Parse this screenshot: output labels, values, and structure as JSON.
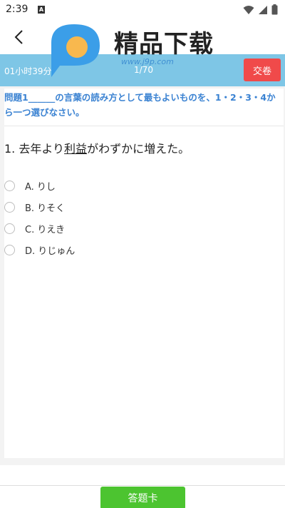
{
  "status_bar": {
    "time": "2:39",
    "app_icon_letter": "A",
    "icons": [
      "wifi-icon",
      "signal-icon",
      "battery-icon"
    ]
  },
  "header": {
    "back_icon": "chevron-left-icon"
  },
  "watermark": {
    "brand_text": "精品下载",
    "url": "www.j9p.com"
  },
  "info_bar": {
    "timer": "01小时39分",
    "progress": "1/70",
    "submit_label": "交卷"
  },
  "question": {
    "instruction": "問題1______の言葉の読み方として最もよいものを、1・2・3・4から一つ選びなさい。",
    "prefix": "1. 去年より",
    "keyword": "利益",
    "suffix": "がわずかに増えた。",
    "options": [
      {
        "label": "A. りし"
      },
      {
        "label": "B. りそく"
      },
      {
        "label": "C. りえき"
      },
      {
        "label": "D. りじゅん"
      }
    ]
  },
  "footer": {
    "answer_card_label": "答题卡"
  },
  "colors": {
    "info_bar": "#7ec6e6",
    "submit_button": "#f04a4a",
    "instruction_text": "#3a82d2",
    "answer_card_button": "#4cc430"
  }
}
